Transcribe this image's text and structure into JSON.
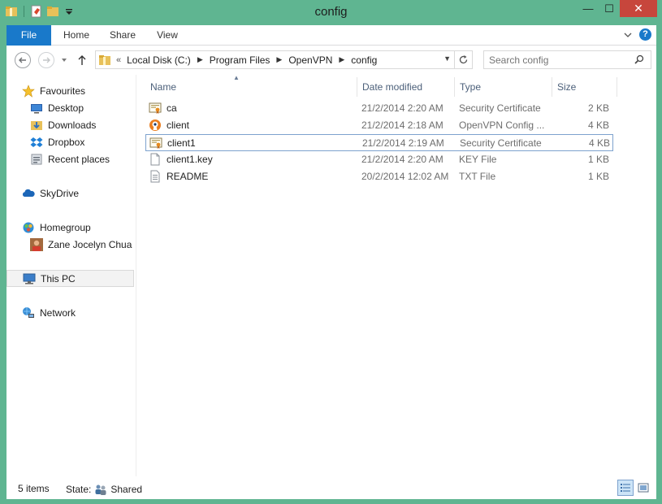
{
  "window": {
    "title": "config"
  },
  "title_buttons": {
    "minimize": "—",
    "maximize": "☐",
    "close": "✕"
  },
  "ribbon": {
    "tabs": {
      "file": "File",
      "home": "Home",
      "share": "Share",
      "view": "View"
    },
    "help": "?"
  },
  "navigation": {
    "address_prefix": "«",
    "breadcrumb": [
      "Local Disk (C:)",
      "Program Files",
      "OpenVPN",
      "config"
    ],
    "search_placeholder": "Search config"
  },
  "sidebar": {
    "items": [
      {
        "label": "Favourites",
        "icon": "star-icon"
      },
      {
        "label": "Desktop",
        "icon": "desktop-icon"
      },
      {
        "label": "Downloads",
        "icon": "downloads-icon"
      },
      {
        "label": "Dropbox",
        "icon": "dropbox-icon"
      },
      {
        "label": "Recent places",
        "icon": "recent-places-icon"
      },
      {
        "label": "SkyDrive",
        "icon": "skydrive-icon"
      },
      {
        "label": "Homegroup",
        "icon": "homegroup-icon"
      },
      {
        "label": "Zane Jocelyn Chua",
        "icon": "user-avatar-icon"
      },
      {
        "label": "This PC",
        "icon": "this-pc-icon"
      },
      {
        "label": "Network",
        "icon": "network-icon"
      }
    ]
  },
  "columns": {
    "name": "Name",
    "date": "Date modified",
    "type": "Type",
    "size": "Size"
  },
  "files": [
    {
      "name": "ca",
      "date": "21/2/2014 2:20 AM",
      "type": "Security Certificate",
      "size": "2 KB",
      "icon": "certificate-icon"
    },
    {
      "name": "client",
      "date": "21/2/2014 2:18 AM",
      "type": "OpenVPN Config ...",
      "size": "4 KB",
      "icon": "openvpn-icon"
    },
    {
      "name": "client1",
      "date": "21/2/2014 2:19 AM",
      "type": "Security Certificate",
      "size": "4 KB",
      "icon": "certificate-icon"
    },
    {
      "name": "client1.key",
      "date": "21/2/2014 2:20 AM",
      "type": "KEY File",
      "size": "1 KB",
      "icon": "blank-file-icon"
    },
    {
      "name": "README",
      "date": "20/2/2014 12:02 AM",
      "type": "TXT File",
      "size": "1 KB",
      "icon": "text-file-icon"
    }
  ],
  "status": {
    "item_count": "5 items",
    "state_label": "State:",
    "state_value": "Shared"
  },
  "colors": {
    "frame": "#5fb591",
    "accent": "#1979ca",
    "close": "#c7463c",
    "selection_border": "#7da2ce"
  }
}
